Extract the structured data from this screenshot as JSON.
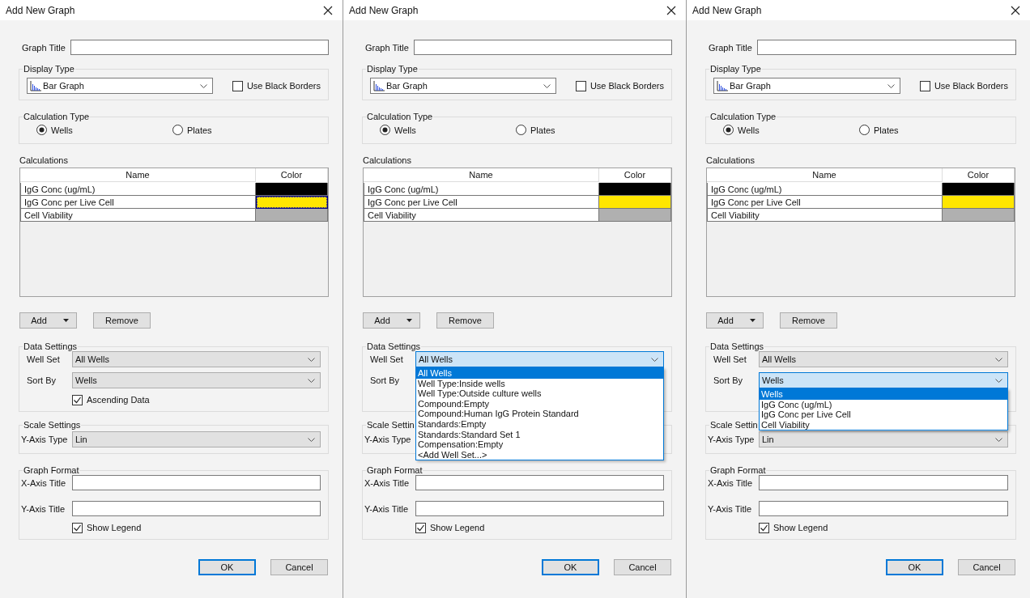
{
  "dialogs": [
    {
      "title": "Add New Graph",
      "graph_title_label": "Graph Title",
      "display_type": {
        "legend": "Display Type",
        "value": "Bar Graph",
        "black_borders": {
          "label": "Use Black Borders",
          "checked": false
        }
      },
      "calculation_type": {
        "legend": "Calculation Type",
        "options": [
          {
            "label": "Wells",
            "selected": true
          },
          {
            "label": "Plates",
            "selected": false
          }
        ]
      },
      "calculations": {
        "legend": "Calculations",
        "columns": [
          "Name",
          "Color"
        ],
        "rows": [
          {
            "name": "IgG Conc (ug/mL)",
            "color": "#000000",
            "selected": false
          },
          {
            "name": "IgG Conc per Live Cell",
            "color": "#ffe600",
            "selected": true
          },
          {
            "name": "Cell Viability",
            "color": "#b0b0b0",
            "selected": false
          }
        ]
      },
      "list_buttons": {
        "add": "Add",
        "remove": "Remove"
      },
      "data_settings": {
        "legend": "Data Settings",
        "well_set": {
          "label": "Well Set",
          "value": "All Wells",
          "open": false
        },
        "sort_by": {
          "label": "Sort By",
          "value": "Wells",
          "open": false
        },
        "ascending": {
          "label": "Ascending Data",
          "checked": true
        }
      },
      "scale_settings": {
        "legend": "Scale Settings",
        "y_axis_type": {
          "label": "Y-Axis Type",
          "value": "Lin"
        }
      },
      "graph_format": {
        "legend": "Graph Format",
        "x_axis_title_label": "X-Axis Title",
        "y_axis_title_label": "Y-Axis Title",
        "show_legend": {
          "label": "Show Legend",
          "checked": true
        }
      },
      "buttons": [
        {
          "label": "OK",
          "default": true
        },
        {
          "label": "Cancel",
          "default": false
        }
      ]
    },
    {
      "title": "Add New Graph",
      "graph_title_label": "Graph Title",
      "display_type": {
        "legend": "Display Type",
        "value": "Bar Graph",
        "black_borders": {
          "label": "Use Black Borders",
          "checked": false
        }
      },
      "calculation_type": {
        "legend": "Calculation Type",
        "options": [
          {
            "label": "Wells",
            "selected": true
          },
          {
            "label": "Plates",
            "selected": false
          }
        ]
      },
      "calculations": {
        "legend": "Calculations",
        "columns": [
          "Name",
          "Color"
        ],
        "rows": [
          {
            "name": "IgG Conc (ug/mL)",
            "color": "#000000",
            "selected": false
          },
          {
            "name": "IgG Conc per Live Cell",
            "color": "#ffe600",
            "selected": false
          },
          {
            "name": "Cell Viability",
            "color": "#b0b0b0",
            "selected": false
          }
        ]
      },
      "list_buttons": {
        "add": "Add",
        "remove": "Remove"
      },
      "data_settings": {
        "legend": "Data Settings",
        "well_set": {
          "label": "Well Set",
          "value": "All Wells",
          "open": true,
          "options": [
            {
              "label": "All Wells",
              "selected": true
            },
            {
              "label": "Well Type:Inside wells",
              "selected": false
            },
            {
              "label": "Well Type:Outside culture wells",
              "selected": false
            },
            {
              "label": "Compound:Empty",
              "selected": false
            },
            {
              "label": "Compound:Human IgG Protein Standard",
              "selected": false
            },
            {
              "label": "Standards:Empty",
              "selected": false
            },
            {
              "label": "Standards:Standard Set 1",
              "selected": false
            },
            {
              "label": "Compensation:Empty",
              "selected": false
            },
            {
              "label": "<Add Well Set...>",
              "selected": false
            }
          ]
        },
        "sort_by": {
          "label": "Sort By"
        }
      },
      "scale_settings": {
        "legend": "Scale Settin",
        "y_axis_type": {
          "label": "Y-Axis Type"
        }
      },
      "graph_format": {
        "legend": "Graph Format",
        "x_axis_title_label": "X-Axis Title",
        "y_axis_title_label": "Y-Axis Title",
        "show_legend": {
          "label": "Show Legend",
          "checked": true
        }
      },
      "buttons": [
        {
          "label": "OK",
          "default": true
        },
        {
          "label": "Cancel",
          "default": false
        }
      ]
    },
    {
      "title": "Add New Graph",
      "graph_title_label": "Graph Title",
      "display_type": {
        "legend": "Display Type",
        "value": "Bar Graph",
        "black_borders": {
          "label": "Use Black Borders",
          "checked": false
        }
      },
      "calculation_type": {
        "legend": "Calculation Type",
        "options": [
          {
            "label": "Wells",
            "selected": true
          },
          {
            "label": "Plates",
            "selected": false
          }
        ]
      },
      "calculations": {
        "legend": "Calculations",
        "columns": [
          "Name",
          "Color"
        ],
        "rows": [
          {
            "name": "IgG Conc (ug/mL)",
            "color": "#000000",
            "selected": false
          },
          {
            "name": "IgG Conc per Live Cell",
            "color": "#ffe600",
            "selected": false
          },
          {
            "name": "Cell Viability",
            "color": "#b0b0b0",
            "selected": false
          }
        ]
      },
      "list_buttons": {
        "add": "Add",
        "remove": "Remove"
      },
      "data_settings": {
        "legend": "Data Settings",
        "well_set": {
          "label": "Well Set",
          "value": "All Wells",
          "open": false
        },
        "sort_by": {
          "label": "Sort By",
          "value": "Wells",
          "open": true,
          "options": [
            {
              "label": "Wells",
              "selected": true
            },
            {
              "label": "IgG Conc (ug/mL)",
              "selected": false
            },
            {
              "label": "IgG Conc per Live Cell",
              "selected": false
            },
            {
              "label": "Cell Viability",
              "selected": false
            }
          ]
        }
      },
      "scale_settings": {
        "legend": "Scale Settin",
        "y_axis_type": {
          "label": "Y-Axis Type",
          "value": "Lin"
        }
      },
      "graph_format": {
        "legend": "Graph Format",
        "x_axis_title_label": "X-Axis Title",
        "y_axis_title_label": "Y-Axis Title",
        "show_legend": {
          "label": "Show Legend",
          "checked": true
        }
      },
      "buttons": [
        {
          "label": "OK",
          "default": true
        },
        {
          "label": "Cancel",
          "default": false
        }
      ]
    }
  ]
}
